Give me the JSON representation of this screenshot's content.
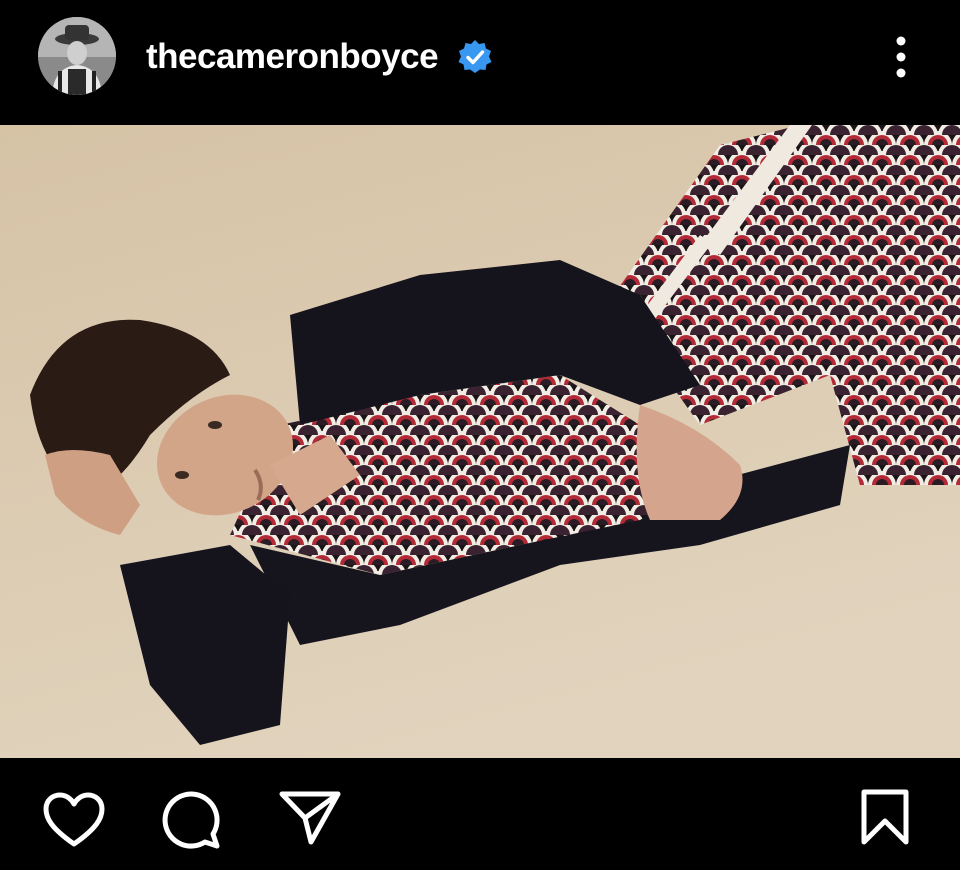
{
  "post": {
    "username": "thecameronboyce",
    "verified": true,
    "icons": {
      "verified": "verified-badge-icon",
      "more": "more-options-icon",
      "like": "heart-icon",
      "comment": "comment-icon",
      "share": "send-icon",
      "save": "bookmark-icon"
    },
    "colors": {
      "background": "#000000",
      "verified": "#3897f0",
      "photo_backdrop": "#d7c6ab"
    }
  }
}
